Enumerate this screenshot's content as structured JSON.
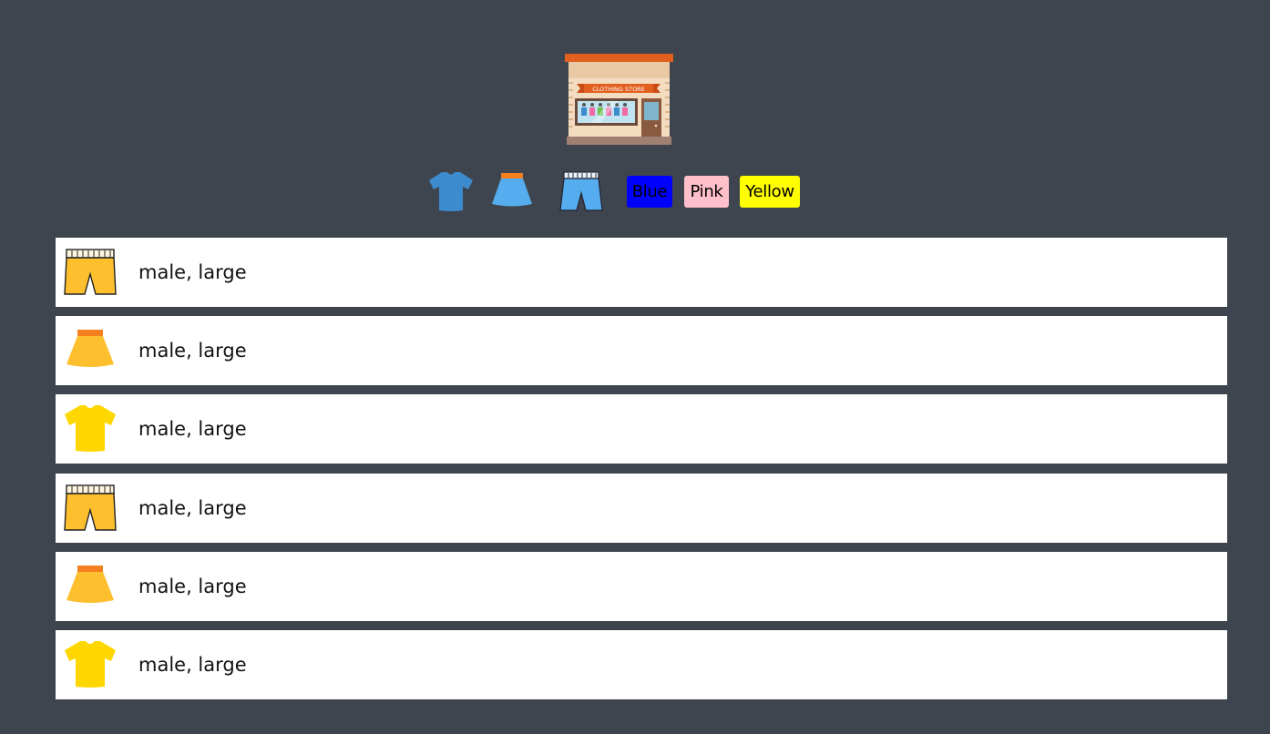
{
  "store": {
    "logo_text": "CLOTHING STORE",
    "logo_icon": "clothing-store-icon"
  },
  "filters": {
    "types": [
      {
        "name": "tshirt-icon",
        "color": "#3d8bcf"
      },
      {
        "name": "skirt-icon",
        "color": "#55acee"
      },
      {
        "name": "shorts-icon",
        "color": "#55acee"
      }
    ],
    "colors": [
      {
        "label": "Blue",
        "bg": "#0000ff"
      },
      {
        "label": "Pink",
        "bg": "#ffc0cb"
      },
      {
        "label": "Yellow",
        "bg": "#ffff00"
      }
    ]
  },
  "items": [
    {
      "type": "shorts",
      "icon": "shorts-icon",
      "color": "#fdbf2d",
      "label": "male, large"
    },
    {
      "type": "skirt",
      "icon": "skirt-icon",
      "color": "#fdbf2d",
      "label": "male, large"
    },
    {
      "type": "tshirt",
      "icon": "tshirt-icon",
      "color": "#ffd700",
      "label": "male, large"
    },
    {
      "type": "shorts",
      "icon": "shorts-icon",
      "color": "#fdbf2d",
      "label": "male, large"
    },
    {
      "type": "skirt",
      "icon": "skirt-icon",
      "color": "#fdbf2d",
      "label": "male, large"
    },
    {
      "type": "tshirt",
      "icon": "tshirt-icon",
      "color": "#ffd700",
      "label": "male, large"
    }
  ]
}
